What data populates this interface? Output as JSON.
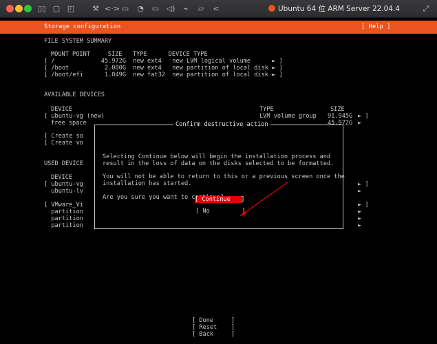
{
  "window": {
    "title": "Ubuntu 64 位 ARM Server 22.04.4",
    "toolbar_icons": [
      "sidebar-icon",
      "stop-icon",
      "snapshot-icon",
      "wrench-icon",
      "code-icon",
      "disk-icon",
      "backup-icon",
      "camera-icon",
      "volume-icon",
      "usb-icon",
      "folder-icon",
      "back-icon",
      "fullscreen-icon"
    ]
  },
  "header": {
    "title": "Storage configuration",
    "help": "[ Help ]"
  },
  "fs_summary": {
    "heading": "FILE SYSTEM SUMMARY",
    "columns": "MOUNT POINT     SIZE   TYPE      DEVICE TYPE",
    "rows": [
      "[ /             45.972G  new ext4   new LVM logical volume      ► ]",
      "[ /boot          2.000G  new ext4   new partition of local disk ► ]",
      "[ /boot/efi      1.049G  new fat32  new partition of local disk ► ]"
    ]
  },
  "available": {
    "heading": "AVAILABLE DEVICES",
    "device_col": "DEVICE",
    "type_col": "TYPE",
    "size_col": "SIZE",
    "vg_name": "[ ubuntu-vg (new)",
    "vg_type": "LVM volume group",
    "vg_size": "91.945G",
    "vg_arrow": "► ]",
    "free": "free space",
    "free_size": "45.972G",
    "free_arrow": "►",
    "create1": "[ Create so",
    "create2": "[ Create vo"
  },
  "used": {
    "heading": "USED DEVICE",
    "device_col": "DEVICE",
    "rows": [
      "[ ubuntu-vg",
      "  ubuntu-lv",
      "[ VMware_Vi",
      "  partition",
      "  partition",
      "  partition"
    ],
    "arrows": [
      "► ]",
      "►",
      "► ]",
      "►",
      "►",
      "►"
    ]
  },
  "dialog": {
    "title": "Confirm destructive action",
    "line1": "Selecting Continue below will begin the installation process and",
    "line2": "result in the loss of data on the disks selected to be formatted.",
    "line3": "You will not be able to return to this or a previous screen once the",
    "line4": "installation has started.",
    "question": "Are you sure you want to continue?",
    "no": "[ No         ]",
    "continue": "[ Continue   ]",
    "highlight_color": "#e30000"
  },
  "footer": {
    "done": "[ Done     ]",
    "reset": "[ Reset    ]",
    "back": "[ Back     ]"
  },
  "colors": {
    "accent": "#e95420",
    "arrow": "#e30000"
  }
}
